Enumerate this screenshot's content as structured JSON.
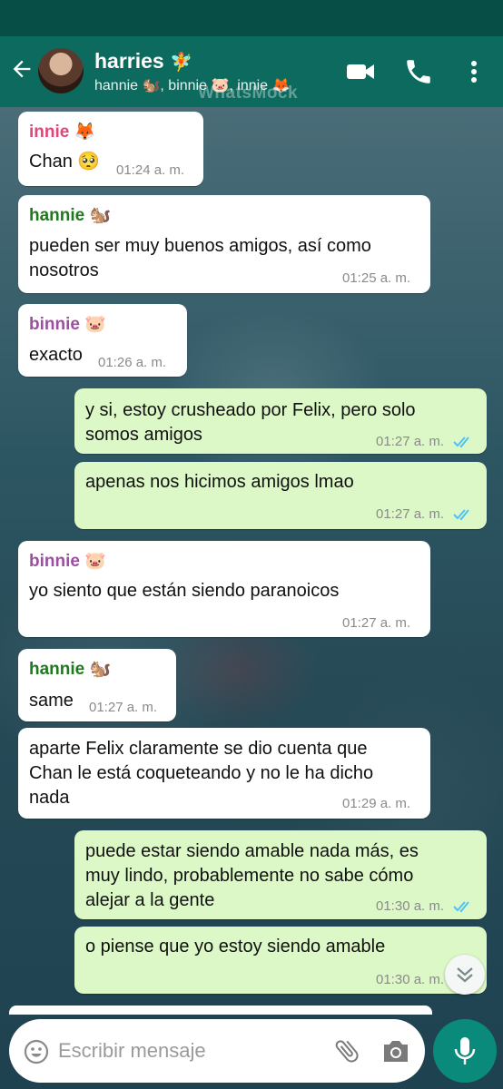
{
  "header": {
    "title": "harries",
    "title_emoji": "🧚",
    "subtitle": "hannie 🐿️, binnie 🐷, innie 🦊",
    "watermark": "WhatsMock"
  },
  "colors": {
    "header_bg": "#0c6b5e",
    "incoming_bubble": "#ffffff",
    "outgoing_bubble": "#dcf8c6",
    "read_ticks": "#4fc3f7",
    "innie": "#e0457b",
    "hannie": "#1f7a1f",
    "binnie": "#9b4f9f"
  },
  "messages": [
    {
      "sender": "innie 🦊",
      "text": "Chan 🥺",
      "time": "01:24 a. m."
    },
    {
      "sender": "hannie 🐿️",
      "text": "pueden ser muy buenos amigos, así como\nnosotros",
      "time": "01:25 a. m."
    },
    {
      "sender": "binnie 🐷",
      "text": "exacto",
      "time": "01:26 a. m."
    },
    {
      "text": "y si, estoy crusheado por Felix, pero solo\nsomos amigos",
      "time": "01:27 a. m."
    },
    {
      "text": "apenas nos hicimos amigos lmao",
      "time": "01:27 a. m."
    },
    {
      "sender": "binnie 🐷",
      "text": "yo siento que están siendo paranoicos",
      "time": "01:27 a. m."
    },
    {
      "sender": "hannie 🐿️",
      "text": "same",
      "time": "01:27 a. m."
    },
    {
      "text": "aparte Felix claramente se dio cuenta que\nChan le está coqueteando y no le ha dicho\nnada",
      "time": "01:29 a. m."
    },
    {
      "text": "puede estar siendo amable nada más, es\nmuy lindo, probablemente no sabe cómo\nalejar a la gente",
      "time": "01:30 a. m."
    },
    {
      "text": "o piense que yo estoy siendo amable",
      "time": "01:30 a. m."
    }
  ],
  "composer": {
    "placeholder": "Escribir mensaje"
  },
  "icons": {
    "back": "arrow-left-icon",
    "video": "video-call-icon",
    "call": "phone-icon",
    "more": "more-vertical-icon",
    "emoji": "emoji-icon",
    "attach": "paperclip-icon",
    "camera": "camera-icon",
    "mic": "microphone-icon",
    "scroll": "chevrons-down-icon"
  }
}
